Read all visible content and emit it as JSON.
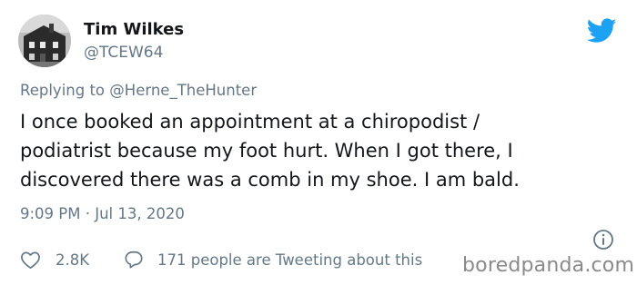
{
  "author": {
    "display_name": "Tim Wilkes",
    "handle": "@TCEW64",
    "avatar_icon": "building-photo-avatar"
  },
  "brand": {
    "icon": "twitter-bird-icon",
    "color": "#1DA1F2"
  },
  "reply": {
    "prefix": "Replying to",
    "mention": "@Herne_TheHunter"
  },
  "tweet": {
    "lines": [
      "I once booked an appointment at a chiropodist /",
      "podiatrist because my foot hurt. When I got there, I",
      "discovered there was a comb in my shoe. I am bald."
    ],
    "timestamp": "9:09 PM · Jul 13, 2020"
  },
  "actions": {
    "like_icon": "heart-outline-icon",
    "like_count": "2.8K",
    "reply_icon": "speech-bubble-icon",
    "tweeting_about": "171 people are Tweeting about this",
    "info_icon": "info-circle-icon"
  },
  "watermark": {
    "text": "boredpanda.com"
  },
  "colors": {
    "text_primary": "#14171A",
    "text_secondary": "#657786",
    "background": "#FFFFFF"
  }
}
